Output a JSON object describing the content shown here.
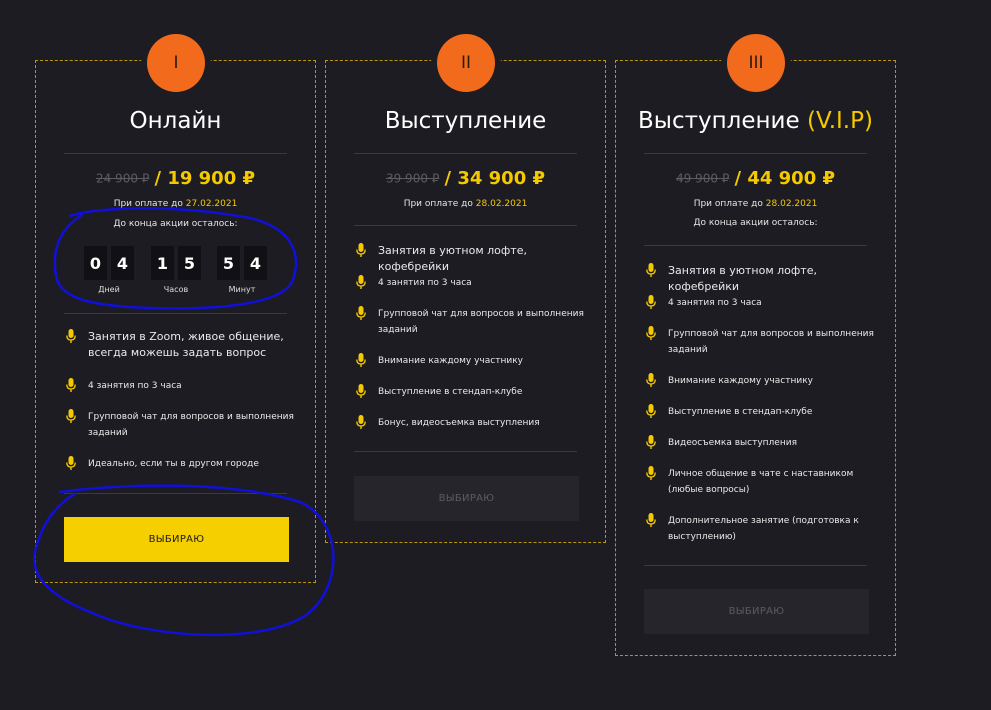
{
  "plans": [
    {
      "numeral": "I",
      "title": "Онлайн",
      "title_highlight": "",
      "old_price": "24 900 ₽",
      "new_price": "/ 19 900 ₽",
      "pay_until_label": "При оплате до",
      "pay_until_date": "27.02.2021",
      "countdown_label": "До конца акции осталось:",
      "countdown": {
        "days": [
          "0",
          "4"
        ],
        "hours": [
          "1",
          "5"
        ],
        "minutes": [
          "5",
          "4"
        ],
        "days_label": "Дней",
        "hours_label": "Часов",
        "minutes_label": "Минут"
      },
      "features": [
        "Занятия в Zoom, живое общение, всегда можешь задать вопрос",
        "4 занятия по 3 часа",
        "Групповой чат для вопросов и выполнения заданий",
        "Идеально, если ты в другом городе"
      ],
      "button_label": "ВЫБИРАЮ",
      "button_state": "active"
    },
    {
      "numeral": "II",
      "title": "Выступление",
      "title_highlight": "",
      "old_price": "39 900 ₽",
      "new_price": "/ 34 900 ₽",
      "pay_until_label": "При оплате до",
      "pay_until_date": "28.02.2021",
      "features": [
        "Занятия в уютном лофте, кофебрейки",
        "4 занятия по 3 часа",
        "Групповой чат для вопросов и выполнения заданий",
        "Внимание каждому участнику",
        "Выступление в стендап-клубе",
        "Бонус, видеосъемка выступления"
      ],
      "button_label": "ВЫБИРАЮ",
      "button_state": "disabled"
    },
    {
      "numeral": "III",
      "title": "Выступление",
      "title_highlight": "(V.I.P)",
      "old_price": "49 900 ₽",
      "new_price": "/ 44 900 ₽",
      "pay_until_label": "При оплате до",
      "pay_until_date": "28.02.2021",
      "countdown_label": "До конца акции осталось:",
      "features": [
        "Занятия в уютном лофте, кофебрейки",
        "4 занятия по 3 часа",
        "Групповой чат для вопросов и выполнения заданий",
        "Внимание каждому участнику",
        "Выступление в стендап-клубе",
        "Видеосъемка выступления",
        "Личное общение в чате с наставником (любые вопросы)",
        "Дополнительное занятие (подготовка к выступлению)"
      ],
      "button_label": "ВЫБИРАЮ",
      "button_state": "disabled"
    }
  ],
  "colors": {
    "background": "#1d1c22",
    "accent": "#f5c900",
    "badge": "#f26b1d",
    "border": "#b8960f",
    "annotation": "#1010d8"
  },
  "icons": {
    "feature_bullet": "microphone-icon"
  }
}
